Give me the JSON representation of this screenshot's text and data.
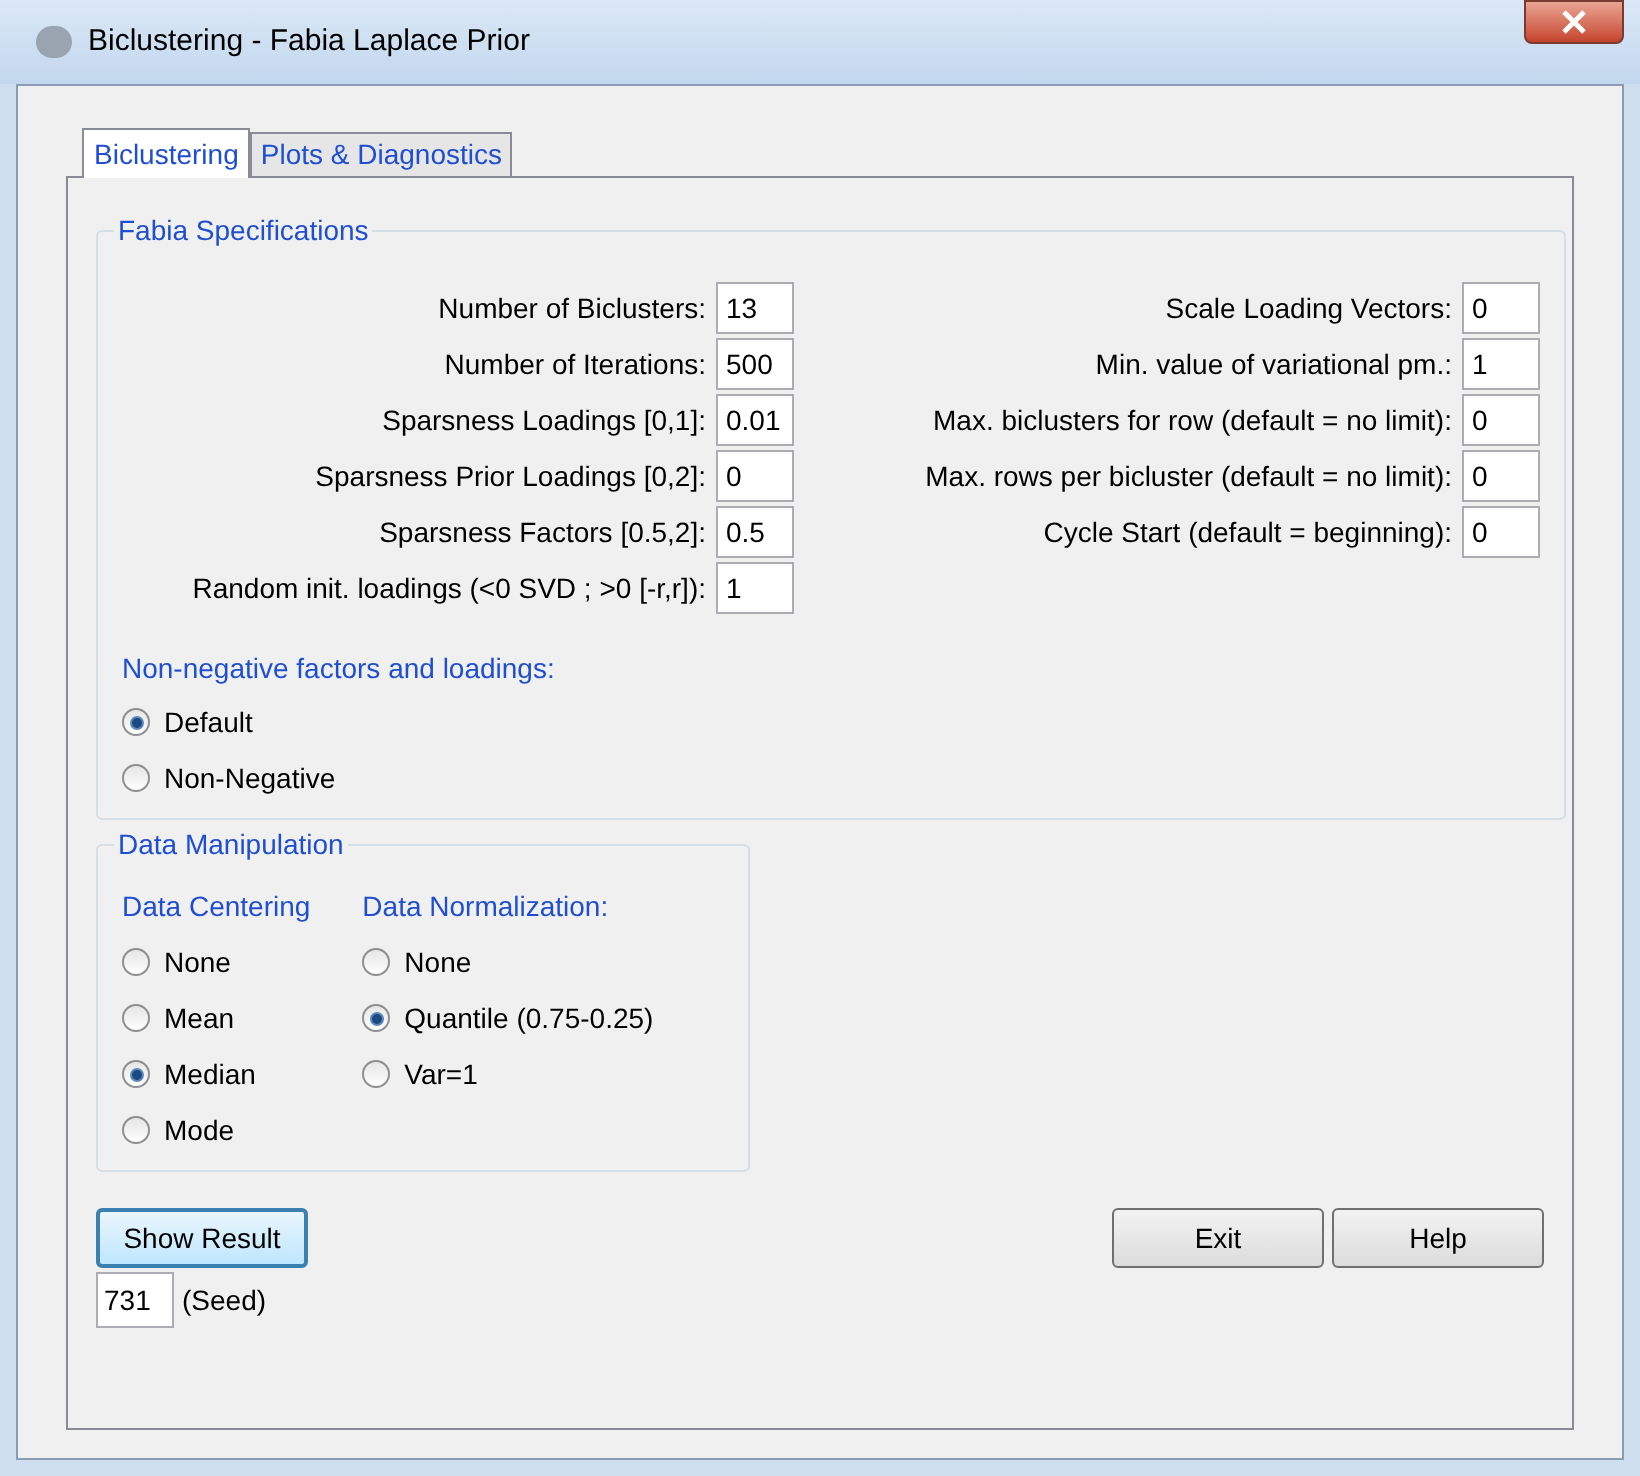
{
  "window": {
    "title": "Biclustering - Fabia Laplace Prior"
  },
  "tabs": [
    {
      "label": "Biclustering",
      "selected": true
    },
    {
      "label": "Plots & Diagnostics",
      "selected": false
    }
  ],
  "fabia_specifications": {
    "title": "Fabia Specifications",
    "left_fields": [
      {
        "label": "Number of Biclusters:",
        "value": "13"
      },
      {
        "label": "Number of Iterations:",
        "value": "500"
      },
      {
        "label": "Sparsness Loadings [0,1]:",
        "value": "0.01"
      },
      {
        "label": "Sparsness Prior Loadings [0,2]:",
        "value": "0"
      },
      {
        "label": "Sparsness Factors [0.5,2]:",
        "value": "0.5"
      },
      {
        "label": "Random init. loadings (<0 SVD ; >0 [-r,r]):",
        "value": "1"
      }
    ],
    "right_fields": [
      {
        "label": "Scale Loading Vectors:",
        "value": "0"
      },
      {
        "label": "Min. value of variational pm.:",
        "value": "1"
      },
      {
        "label": "Max. biclusters for row (default = no limit):",
        "value": "0"
      },
      {
        "label": "Max. rows per bicluster (default = no limit):",
        "value": "0"
      },
      {
        "label": "Cycle Start (default = beginning):",
        "value": "0"
      }
    ],
    "nonnegative": {
      "title": "Non-negative factors and loadings:",
      "options": [
        {
          "label": "Default",
          "selected": true
        },
        {
          "label": "Non-Negative",
          "selected": false
        }
      ]
    }
  },
  "data_manipulation": {
    "title": "Data Manipulation",
    "centering": {
      "title": "Data Centering",
      "options": [
        {
          "label": "None",
          "selected": false
        },
        {
          "label": "Mean",
          "selected": false
        },
        {
          "label": "Median",
          "selected": true
        },
        {
          "label": "Mode",
          "selected": false
        }
      ]
    },
    "normalization": {
      "title": "Data Normalization:",
      "options": [
        {
          "label": "None",
          "selected": false
        },
        {
          "label": "Quantile (0.75-0.25)",
          "selected": true
        },
        {
          "label": "Var=1",
          "selected": false
        }
      ]
    }
  },
  "show_result": "Show Result",
  "seed": {
    "value": "731",
    "label": "(Seed)"
  },
  "buttons": [
    "Exit",
    "Help"
  ]
}
